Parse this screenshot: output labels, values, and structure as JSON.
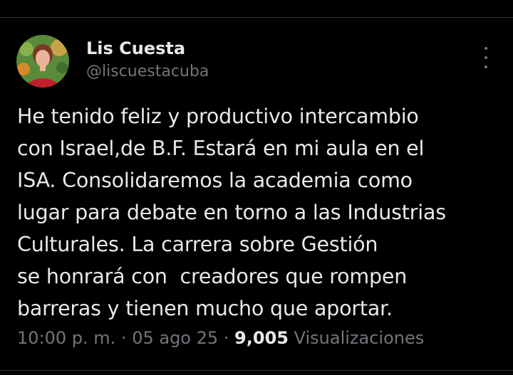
{
  "tweet": {
    "author_name": "Lis Cuesta",
    "author_handle": "@liscuestacuba",
    "text_lines": [
      "He tenido feliz y productivo intercambio",
      "con Israel,de B.F. Estará en mi aula en el",
      "ISA. Consolidaremos la academia como",
      "lugar para debate en torno a las Industrias",
      "Culturales. La carrera sobre Gestión",
      "se honrará con  creadores que rompen",
      "barreras y tienen mucho que aportar."
    ],
    "time": "10:00 p. m.",
    "date": "05 ago 25",
    "separator": " · ",
    "views_count": "9,005",
    "views_label": "Visualizaciones"
  },
  "icons": {
    "more": "more-vertical-icon",
    "avatar": "avatar"
  },
  "colors": {
    "background": "#000000",
    "primary_text": "#e7e9ea",
    "secondary_text": "#71767b",
    "divider": "#2f3336"
  }
}
